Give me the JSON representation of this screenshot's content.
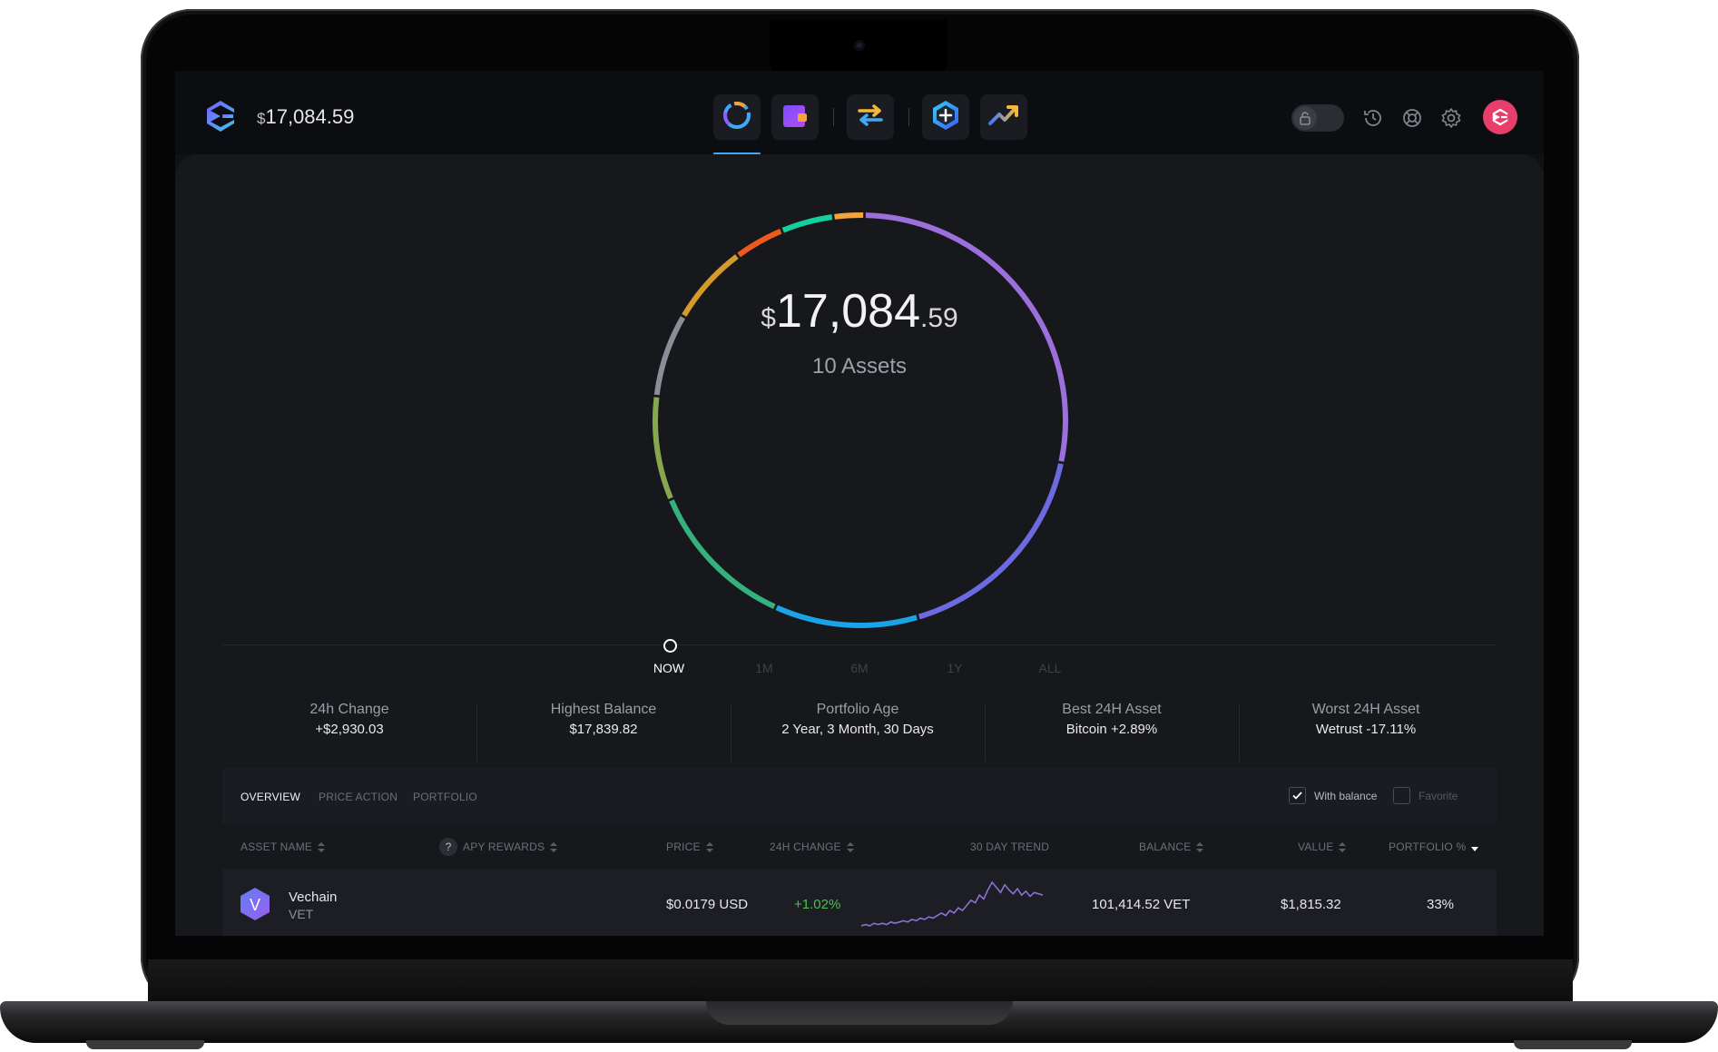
{
  "app": {
    "top_balance_symbol": "$",
    "top_balance_value": "17,084.59",
    "nav": [
      {
        "name": "portfolio-icon",
        "active": true
      },
      {
        "name": "wallet-icon"
      },
      {
        "name": "exchange-icon"
      },
      {
        "name": "app-store-icon"
      },
      {
        "name": "trending-icon"
      }
    ]
  },
  "portfolio": {
    "symbol": "$",
    "whole": "17,084",
    "cents": ".59",
    "assets_label": "10 Assets"
  },
  "timeline": [
    "NOW",
    "1M",
    "6M",
    "1Y",
    "ALL"
  ],
  "stats": [
    {
      "label": "24h Change",
      "value": "+$2,930.03"
    },
    {
      "label": "Highest Balance",
      "value": "$17,839.82"
    },
    {
      "label": "Portfolio Age",
      "value": "2 Year, 3 Month, 30 Days"
    },
    {
      "label": "Best 24H Asset",
      "value": "Bitcoin +2.89%"
    },
    {
      "label": "Worst 24H Asset",
      "value": "Wetrust -17.11%"
    }
  ],
  "tabs": [
    "OVERVIEW",
    "PRICE ACTION",
    "PORTFOLIO"
  ],
  "filters": {
    "with_balance": "With balance",
    "with_balance_checked": true,
    "favorite": "Favorite",
    "favorite_checked": false
  },
  "columns": {
    "qmark": "?",
    "asset_name": "ASSET NAME",
    "apy_rewards": "APY REWARDS",
    "price": "PRICE",
    "change_24h": "24H CHANGE",
    "trend": "30 DAY TREND",
    "balance": "BALANCE",
    "value": "VALUE",
    "portfolio_pct": "PORTFOLIO %"
  },
  "rows": [
    {
      "logo_letter": "V",
      "name": "Vechain",
      "ticker": "VET",
      "price": "$0.0179 USD",
      "change": "+1.02%",
      "balance": "101,414.52 VET",
      "value": "$1,815.32",
      "portfolio_pct": "33%",
      "trend": [
        10,
        11,
        10,
        12,
        11,
        12,
        11,
        13,
        12,
        13,
        14,
        13,
        15,
        14,
        16,
        15,
        17,
        16,
        18,
        20,
        18,
        22,
        20,
        24,
        22,
        26,
        30,
        28,
        34,
        31,
        38,
        44,
        40,
        36,
        42,
        38,
        35,
        39,
        34,
        37,
        33,
        36,
        35,
        34
      ]
    }
  ],
  "colors": {
    "accent": "#3fa9f5",
    "positive": "#4ec04e",
    "ring_segments": [
      {
        "color": "#9b6fdc",
        "share": 0.277
      },
      {
        "color": "#6c6ae0",
        "share": 0.17
      },
      {
        "color": "#1aa3e8",
        "share": 0.112
      },
      {
        "color": "#36b07f",
        "share": 0.118
      },
      {
        "color": "#86a74f",
        "share": 0.081
      },
      {
        "color": "#8a8e96",
        "share": 0.065
      },
      {
        "color": "#d49a2a",
        "share": 0.063
      },
      {
        "color": "#ee5a1e",
        "share": 0.039
      },
      {
        "color": "#14d0a0",
        "share": 0.041
      },
      {
        "color": "#f4a33a",
        "share": 0.024
      }
    ]
  }
}
